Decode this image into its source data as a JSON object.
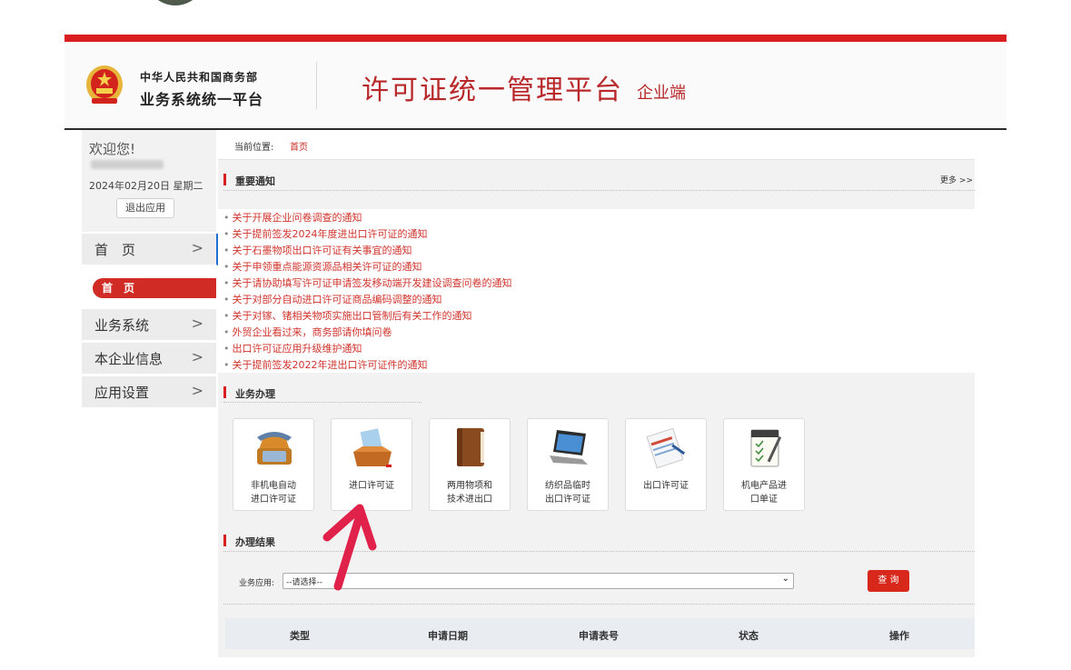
{
  "header": {
    "org_line1": "中华人民共和国商务部",
    "org_line2": "业务系统统一平台",
    "platform_title": "许可证统一管理平台",
    "platform_subtitle": "企业端"
  },
  "sidebar": {
    "welcome": "欢迎您!",
    "date": "2024年02月20日 星期二",
    "logout_label": "退出应用",
    "items": [
      {
        "label": "首　页",
        "chevron": ">"
      },
      {
        "label": "首　页"
      },
      {
        "label": "业务系统",
        "chevron": ">"
      },
      {
        "label": "本企业信息",
        "chevron": ">"
      },
      {
        "label": "应用设置",
        "chevron": ">"
      }
    ]
  },
  "breadcrumb": {
    "label": "当前位置:",
    "current": "首页"
  },
  "notices": {
    "title": "重要通知",
    "more": "更多 >>",
    "items": [
      "关于开展企业问卷调查的通知",
      "关于提前签发2024年度进出口许可证的通知",
      "关于石墨物项出口许可证有关事宜的通知",
      "关于申领重点能源资源品相关许可证的通知",
      "关于请协助填写许可证申请签发移动端开发建设调查问卷的通知",
      "关于对部分自动进口许可证商品编码调整的通知",
      "关于对镓、锗相关物项实施出口管制后有关工作的通知",
      "外贸企业看过来，商务部请你填问卷",
      "出口许可证应用升级维护通知",
      "关于提前签发2022年进出口许可证件的通知"
    ]
  },
  "business": {
    "title": "业务办理",
    "tiles": [
      {
        "line1": "非机电自动",
        "line2": "进口许可证",
        "icon": "telephone-icon"
      },
      {
        "line1": "进口许可证",
        "line2": "",
        "icon": "inbox-tray-icon"
      },
      {
        "line1": "两用物项和",
        "line2": "技术进出口",
        "icon": "book-icon"
      },
      {
        "line1": "纺织品临时",
        "line2": "出口许可证",
        "icon": "laptop-icon"
      },
      {
        "line1": "出口许可证",
        "line2": "",
        "icon": "document-pen-icon"
      },
      {
        "line1": "机电产品进",
        "line2": "口单证",
        "icon": "notebook-icon"
      }
    ]
  },
  "results": {
    "title": "办理结果",
    "filter_label": "业务应用:",
    "select_value": "--请选择--",
    "query_label": "查 询",
    "columns": [
      "类型",
      "申请日期",
      "申请表号",
      "状态",
      "操作"
    ]
  },
  "colors": {
    "brand_red": "#d81e1e",
    "title_red": "#b8282a",
    "link_red": "#d0342c",
    "annotation_arrow": "#e0224a"
  },
  "annotation": {
    "icon": "red-arrow-icon"
  }
}
